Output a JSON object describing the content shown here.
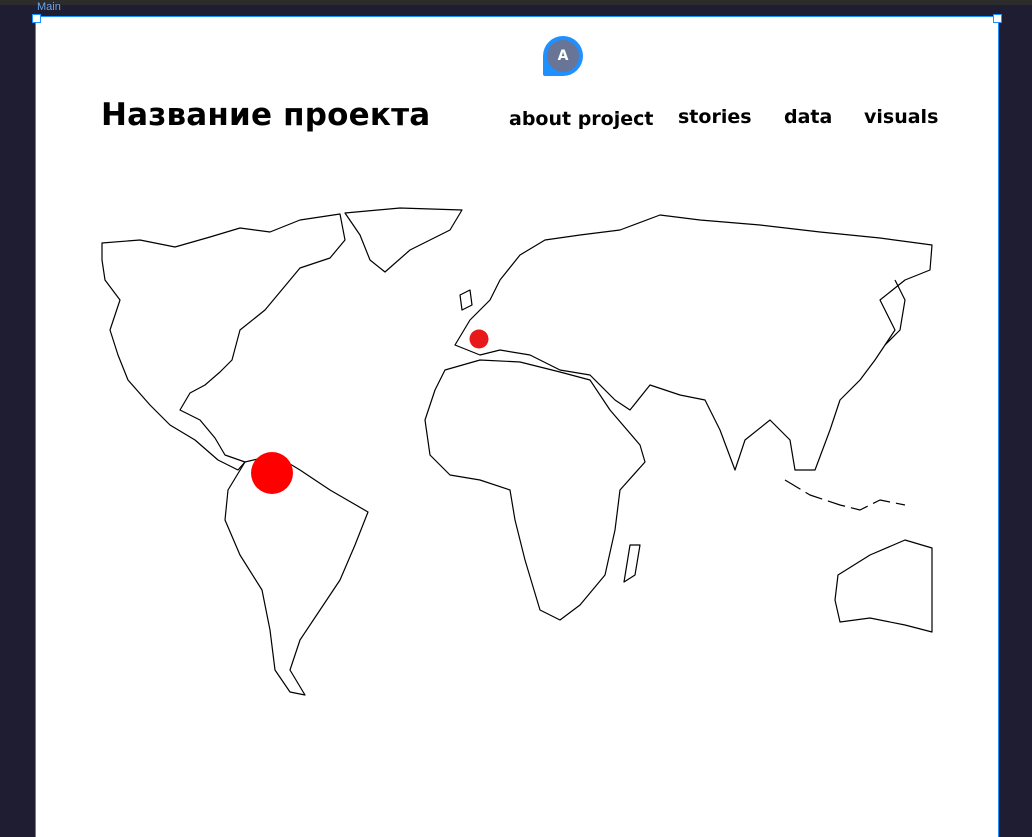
{
  "canvas": {
    "frame_label": "Main",
    "collaborator_initial": "A"
  },
  "header": {
    "title": "Название проекта",
    "nav": [
      {
        "label": "about project"
      },
      {
        "label": "stories"
      },
      {
        "label": "data"
      },
      {
        "label": "visuals"
      }
    ]
  },
  "map": {
    "marker_color": "#ff0000",
    "markers": [
      {
        "location": "Spain",
        "size": "small"
      },
      {
        "location": "Venezuela",
        "size": "large"
      }
    ]
  },
  "colors": {
    "canvas_bg": "#1f1d31",
    "selection": "#1e90ff",
    "avatar": "#687597"
  }
}
